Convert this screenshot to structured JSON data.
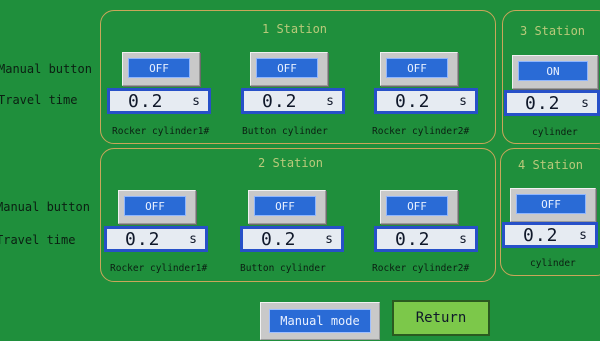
{
  "row_labels": {
    "manual_button": "Manual button",
    "travel_time": "Travel time"
  },
  "stations": [
    {
      "title": "1 Station",
      "cylinders": [
        {
          "button": "OFF",
          "time": "0.2",
          "unit": "s",
          "label": "Rocker cylinder1#"
        },
        {
          "button": "OFF",
          "time": "0.2",
          "unit": "s",
          "label": "Button cylinder"
        },
        {
          "button": "OFF",
          "time": "0.2",
          "unit": "s",
          "label": "Rocker cylinder2#"
        }
      ]
    },
    {
      "title": "3 Station",
      "cylinders": [
        {
          "button": "ON",
          "time": "0.2",
          "unit": "s",
          "label": "cylinder"
        }
      ]
    },
    {
      "title": "2 Station",
      "cylinders": [
        {
          "button": "OFF",
          "time": "0.2",
          "unit": "s",
          "label": "Rocker cylinder1#"
        },
        {
          "button": "OFF",
          "time": "0.2",
          "unit": "s",
          "label": "Button cylinder"
        },
        {
          "button": "OFF",
          "time": "0.2",
          "unit": "s",
          "label": "Rocker cylinder2#"
        }
      ]
    },
    {
      "title": "4 Station",
      "cylinders": [
        {
          "button": "OFF",
          "time": "0.2",
          "unit": "s",
          "label": "cylinder"
        }
      ]
    }
  ],
  "footer": {
    "manual_mode": "Manual mode",
    "return": "Return"
  },
  "colors": {
    "background": "#1f8f3c",
    "button_blue": "#2a6bd6",
    "frame_border": "#c9a65a",
    "return_green": "#7cc84a"
  }
}
